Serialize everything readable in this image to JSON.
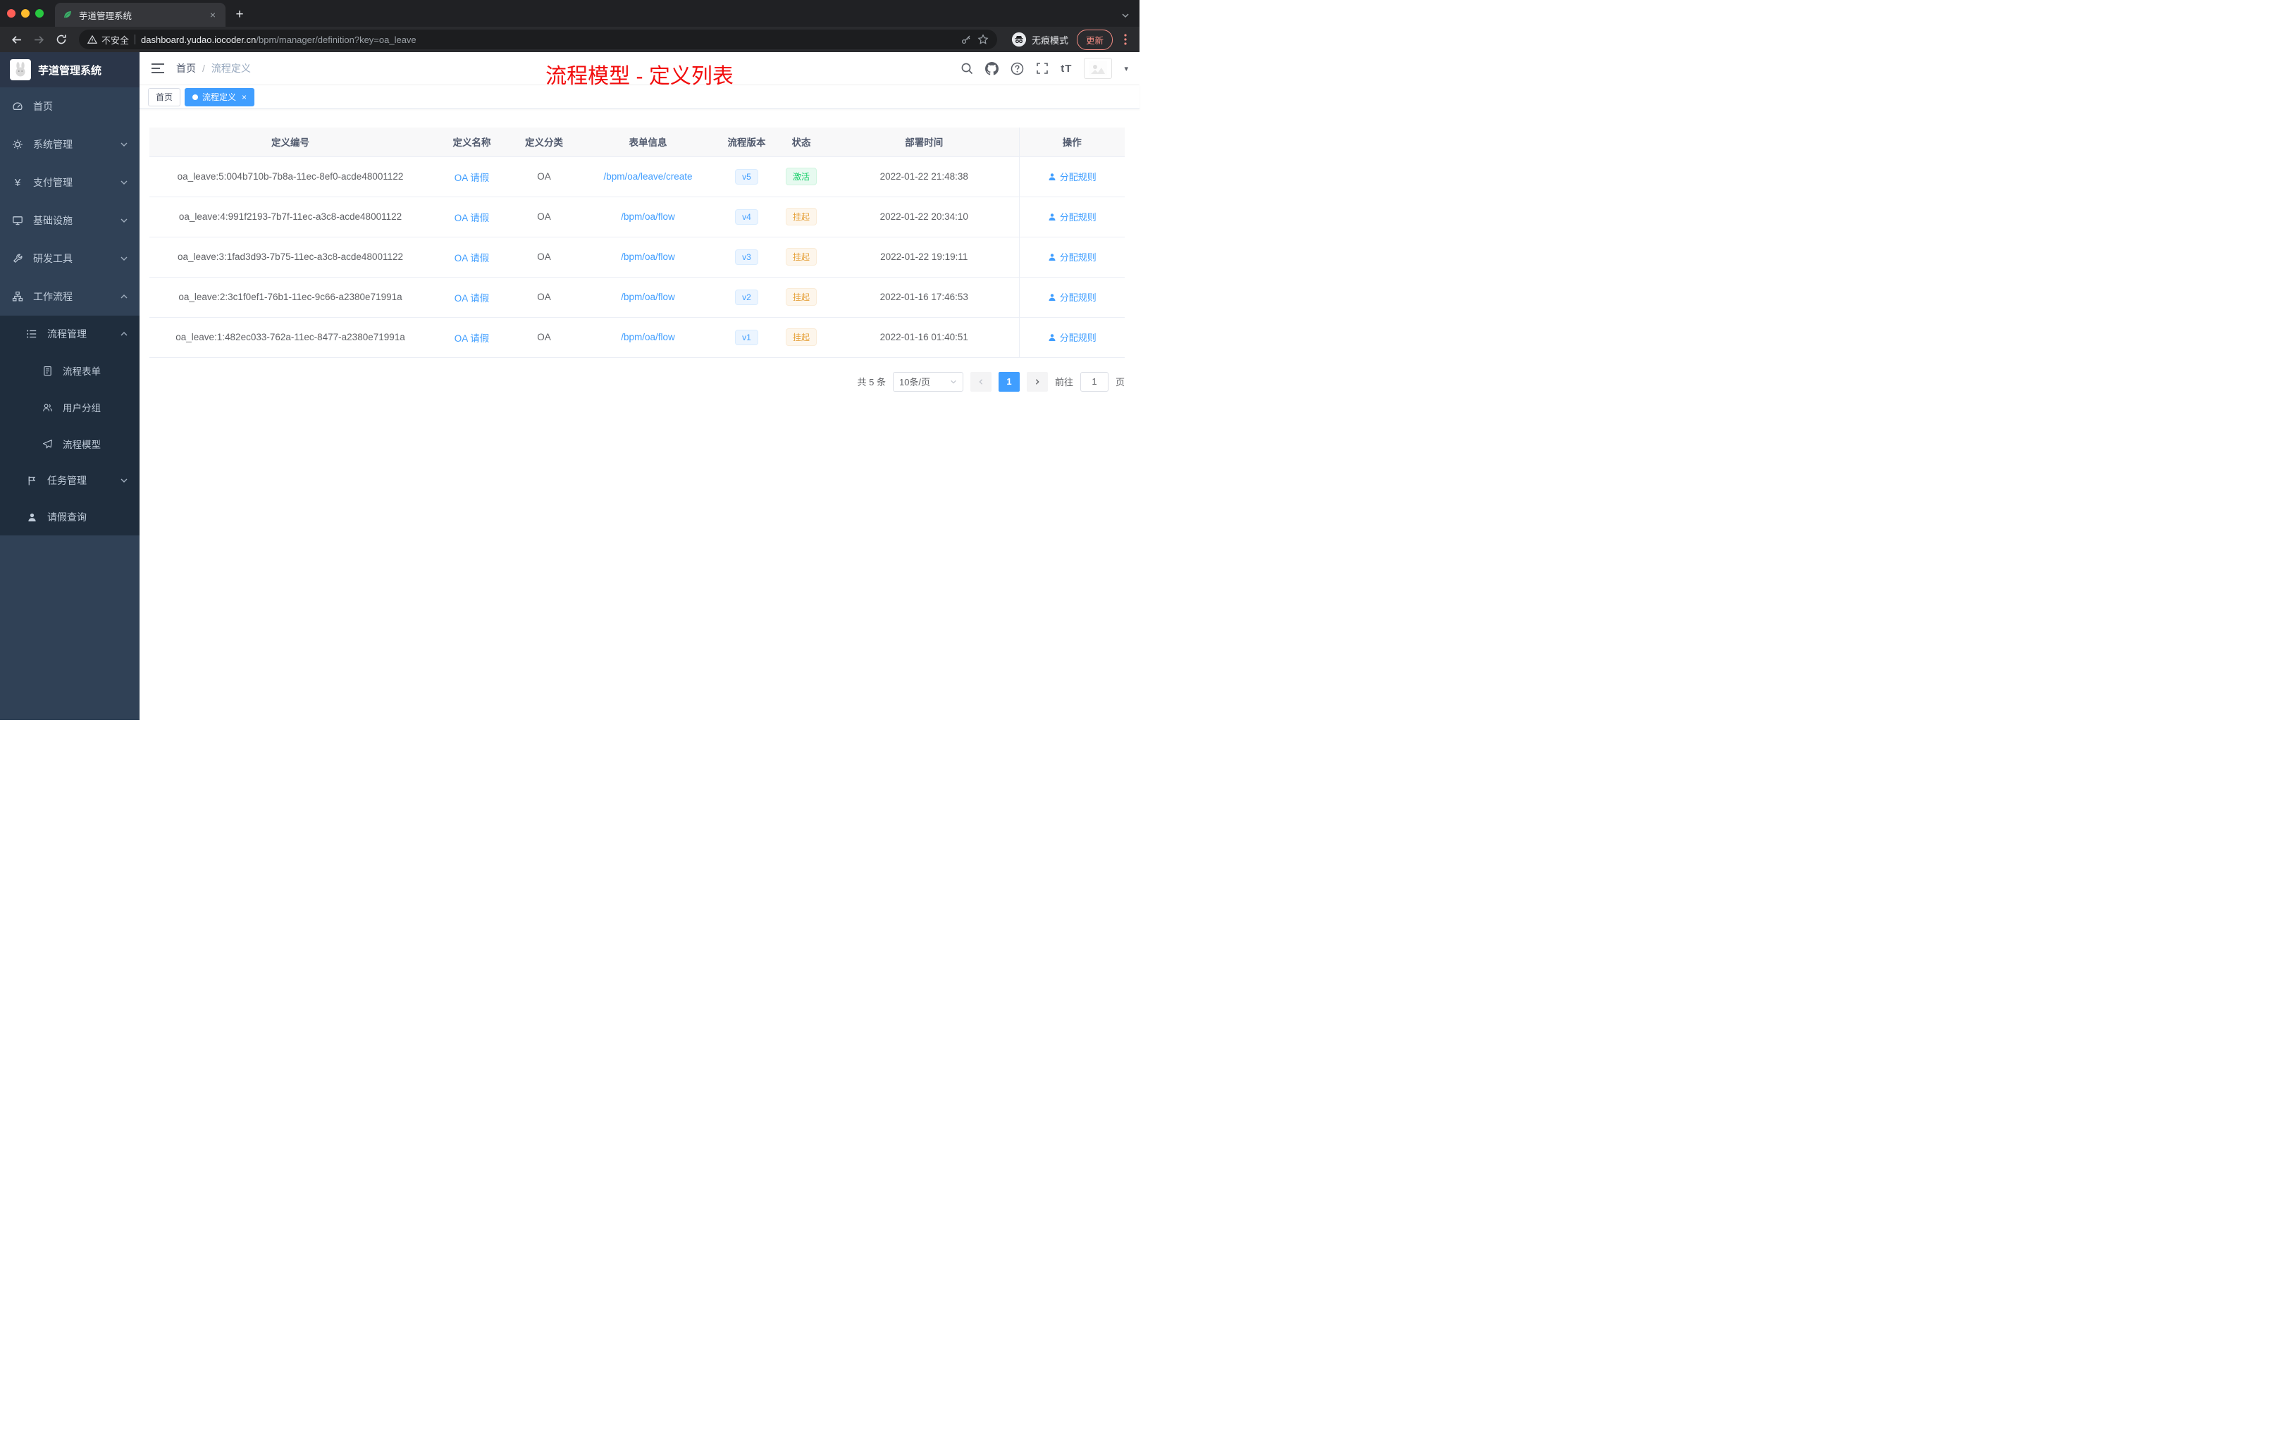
{
  "colors": {
    "accent": "#409eff",
    "success": "#13ce66",
    "warning": "#e6a23c",
    "annotation_red": "#f20d0d",
    "sidebar_bg": "#304156",
    "submenu_bg": "#1f2d3d"
  },
  "browser": {
    "tab": {
      "title": "芋道管理系统",
      "close_glyph": "×",
      "new_tab_glyph": "+"
    },
    "address": {
      "security_label": "不安全",
      "host": "dashboard.yudao.iocoder.cn",
      "path": "/bpm/manager/definition?key=oa_leave",
      "incognito_label": "无痕模式",
      "update_label": "更新"
    }
  },
  "sidebar": {
    "logo_title": "芋道管理系统",
    "top_items": [
      "首页",
      "系统管理",
      "支付管理",
      "基础设施",
      "研发工具",
      "工作流程"
    ],
    "process_group": "流程管理",
    "process_children": [
      "流程表单",
      "用户分组",
      "流程模型"
    ],
    "task_group": "任务管理",
    "leave_item": "请假查询"
  },
  "header": {
    "breadcrumb_home": "首页",
    "breadcrumb_sep": "/",
    "breadcrumb_current": "流程定义",
    "annotation": "流程模型 - 定义列表",
    "font_size_label": "tT",
    "avatar_caret": "▾"
  },
  "tags": {
    "home": "首页",
    "active": "流程定义",
    "close_glyph": "×"
  },
  "table": {
    "columns": [
      "定义编号",
      "定义名称",
      "定义分类",
      "表单信息",
      "流程版本",
      "状态",
      "部署时间",
      "操作"
    ],
    "rows": [
      {
        "id": "oa_leave:5:004b710b-7b8a-11ec-8ef0-acde48001122",
        "name": "OA 请假",
        "category": "OA",
        "form": "/bpm/oa/leave/create",
        "version": "v5",
        "status": "激活",
        "status_type": "success",
        "time": "2022-01-22 21:48:38",
        "action": "分配规则"
      },
      {
        "id": "oa_leave:4:991f2193-7b7f-11ec-a3c8-acde48001122",
        "name": "OA 请假",
        "category": "OA",
        "form": "/bpm/oa/flow",
        "version": "v4",
        "status": "挂起",
        "status_type": "warning",
        "time": "2022-01-22 20:34:10",
        "action": "分配规则"
      },
      {
        "id": "oa_leave:3:1fad3d93-7b75-11ec-a3c8-acde48001122",
        "name": "OA 请假",
        "category": "OA",
        "form": "/bpm/oa/flow",
        "version": "v3",
        "status": "挂起",
        "status_type": "warning",
        "time": "2022-01-22 19:19:11",
        "action": "分配规则"
      },
      {
        "id": "oa_leave:2:3c1f0ef1-76b1-11ec-9c66-a2380e71991a",
        "name": "OA 请假",
        "category": "OA",
        "form": "/bpm/oa/flow",
        "version": "v2",
        "status": "挂起",
        "status_type": "warning",
        "time": "2022-01-16 17:46:53",
        "action": "分配规则"
      },
      {
        "id": "oa_leave:1:482ec033-762a-11ec-8477-a2380e71991a",
        "name": "OA 请假",
        "category": "OA",
        "form": "/bpm/oa/flow",
        "version": "v1",
        "status": "挂起",
        "status_type": "warning",
        "time": "2022-01-16 01:40:51",
        "action": "分配规则"
      }
    ]
  },
  "pagination": {
    "total": "共 5 条",
    "page_size": "10条/页",
    "current_page": "1",
    "goto_label": "前往",
    "goto_value": "1",
    "unit": "页"
  }
}
